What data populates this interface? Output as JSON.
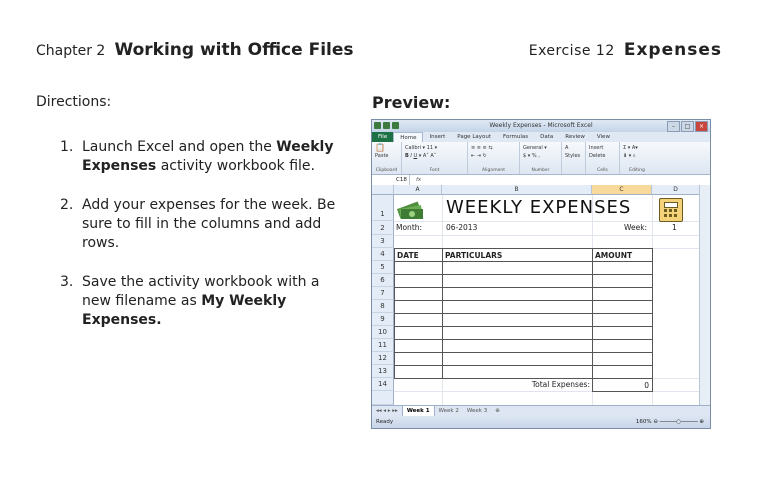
{
  "header": {
    "chapter": "Chapter 2",
    "chapter_title": "Working with Office Files",
    "exercise": "Exercise 12",
    "exercise_title": "Expenses"
  },
  "directions": {
    "label": "Directions:",
    "steps": [
      {
        "num": "1.",
        "a": "Launch Excel and open the ",
        "b": "Weekly Expenses",
        "c": " activity workbook file."
      },
      {
        "num": "2.",
        "a": "Add your expenses for the week. Be sure to fill in the columns and add rows.",
        "b": "",
        "c": ""
      },
      {
        "num": "3.",
        "a": "Save the activity workbook with a new filename as ",
        "b": "My Weekly Expenses.",
        "c": ""
      }
    ]
  },
  "preview": {
    "label": "Preview:",
    "window_title": "Weekly Expenses - Microsoft Excel",
    "ribbon_tabs": [
      "File",
      "Home",
      "Insert",
      "Page Layout",
      "Formulas",
      "Data",
      "Review",
      "View"
    ],
    "groups": {
      "clipboard": {
        "label": "Clipboard",
        "paste": "Paste"
      },
      "font": {
        "label": "Font",
        "name": "Calibri",
        "size": "11"
      },
      "alignment": {
        "label": "Alignment"
      },
      "number": {
        "label": "Number",
        "format": "General"
      },
      "styles": {
        "label": "Styles"
      },
      "cells": {
        "label": "Cells",
        "insert": "Insert",
        "delete": "Delete",
        "format": "Format"
      },
      "editing": {
        "label": "Editing"
      }
    },
    "name_box": "C18",
    "fx": "fx",
    "columns": [
      "A",
      "B",
      "C",
      "D"
    ],
    "rows": [
      "1",
      "2",
      "3",
      "4",
      "5",
      "6",
      "7",
      "8",
      "9",
      "10",
      "11",
      "12",
      "13",
      "14"
    ],
    "sheet": {
      "title": "WEEKLY EXPENSES",
      "month_label": "Month:",
      "month_value": "06-2013",
      "week_label": "Week:",
      "week_value": "1",
      "col_date": "DATE",
      "col_particulars": "PARTICULARS",
      "col_amount": "AMOUNT",
      "total_label": "Total Expenses:",
      "total_value": "0"
    },
    "sheet_tabs": [
      "Week 1",
      "Week 2",
      "Week 3"
    ],
    "status": "Ready",
    "zoom": "160%"
  }
}
